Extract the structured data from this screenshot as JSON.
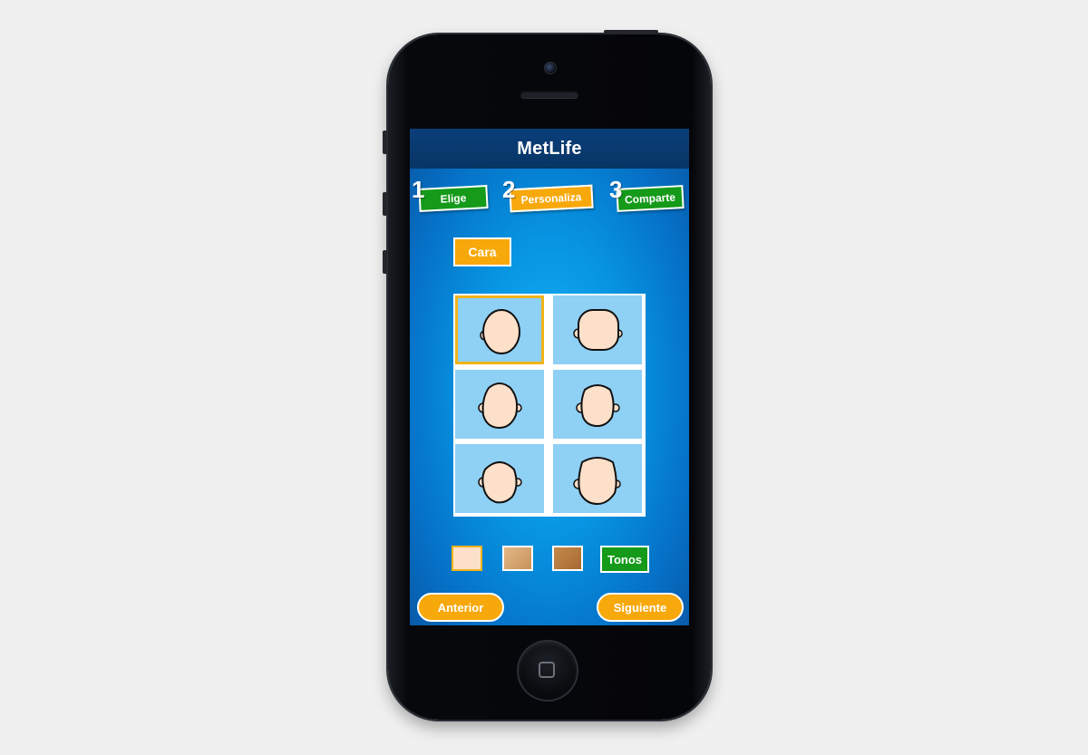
{
  "app": {
    "logo": "MetLife"
  },
  "steps": [
    {
      "number": "1",
      "label": "Elige",
      "color": "#159a1a"
    },
    {
      "number": "2",
      "label": "Personaliza",
      "color": "#f7a80b"
    },
    {
      "number": "3",
      "label": "Comparte",
      "color": "#159a1a"
    }
  ],
  "category_tab": {
    "label": "Cara"
  },
  "face_grid": {
    "columns": 2,
    "rows": 3,
    "selected_index": 0
  },
  "tones": {
    "swatches": [
      {
        "color": "#fce0c8",
        "selected": true
      },
      {
        "color": "#d6a570",
        "selected": false
      },
      {
        "color": "#b27a3f",
        "selected": false
      }
    ],
    "button_label": "Tonos"
  },
  "navigation": {
    "prev_label": "Anterior",
    "next_label": "Siguiente"
  },
  "colors": {
    "accent_orange": "#f7a80b",
    "accent_green": "#159a1a",
    "skin": "#fde0c9",
    "cell_bg": "#8fd0f5"
  }
}
